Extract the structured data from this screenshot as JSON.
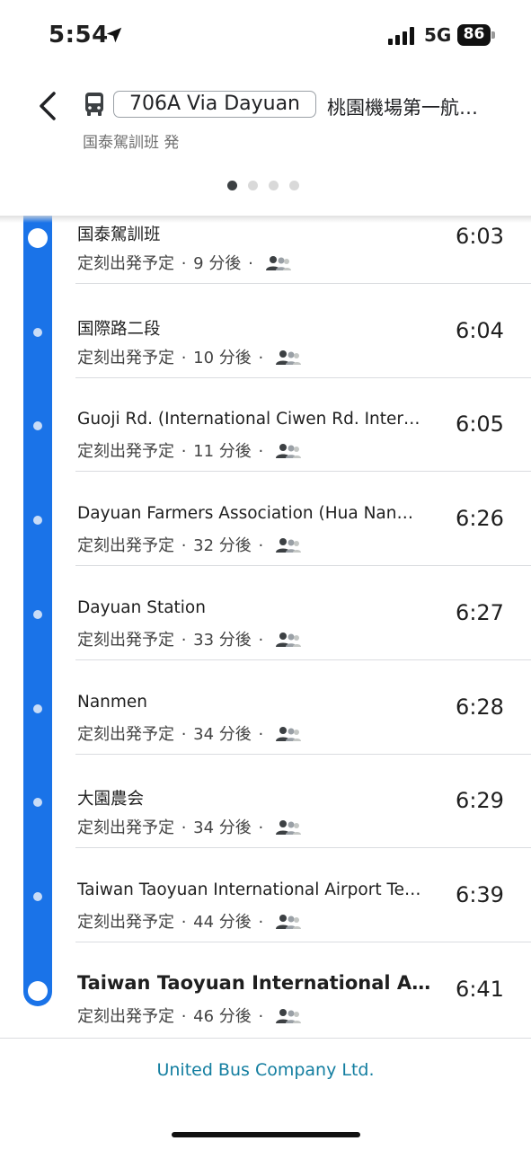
{
  "status_bar": {
    "time": "5:54",
    "network": "5G",
    "battery": "86",
    "icons": [
      "location-arrow-icon",
      "signal-bars-icon",
      "battery-icon"
    ]
  },
  "header": {
    "route_label": "706A Via Dayuan",
    "destination": "桃園機場第一航…",
    "subtitle": "国泰駕訓班 発",
    "pager": {
      "count": 4,
      "active_index": 0
    },
    "icons": [
      "back-chevron-icon",
      "bus-icon"
    ]
  },
  "stops": [
    {
      "name": "国泰駕訓班",
      "status": "定刻出発予定",
      "eta": "9 分後",
      "time": "6:03",
      "terminal": true
    },
    {
      "name": "国際路二段",
      "status": "定刻出発予定",
      "eta": "10 分後",
      "time": "6:04",
      "terminal": false
    },
    {
      "name": "Guoji Rd. (International Ciwen Rd. Inter…",
      "status": "定刻出発予定",
      "eta": "11 分後",
      "time": "6:05",
      "terminal": false
    },
    {
      "name": "Dayuan Farmers Association (Hua Nan…",
      "status": "定刻出発予定",
      "eta": "32 分後",
      "time": "6:26",
      "terminal": false
    },
    {
      "name": "Dayuan Station",
      "status": "定刻出発予定",
      "eta": "33 分後",
      "time": "6:27",
      "terminal": false
    },
    {
      "name": "Nanmen",
      "status": "定刻出発予定",
      "eta": "34 分後",
      "time": "6:28",
      "terminal": false
    },
    {
      "name": "大園農会",
      "status": "定刻出発予定",
      "eta": "34 分後",
      "time": "6:29",
      "terminal": false
    },
    {
      "name": "Taiwan Taoyuan International Airport Te…",
      "status": "定刻出発予定",
      "eta": "44 分後",
      "time": "6:39",
      "terminal": false
    },
    {
      "name": "Taiwan Taoyuan International Airp…",
      "status": "定刻出発予定",
      "eta": "46 分後",
      "time": "6:41",
      "terminal": true
    }
  ],
  "footer": {
    "operator": "United Bus Company Ltd."
  },
  "colors": {
    "route_line": "#1a73e8",
    "operator_link": "#137ea0",
    "divider": "#dadce0"
  }
}
